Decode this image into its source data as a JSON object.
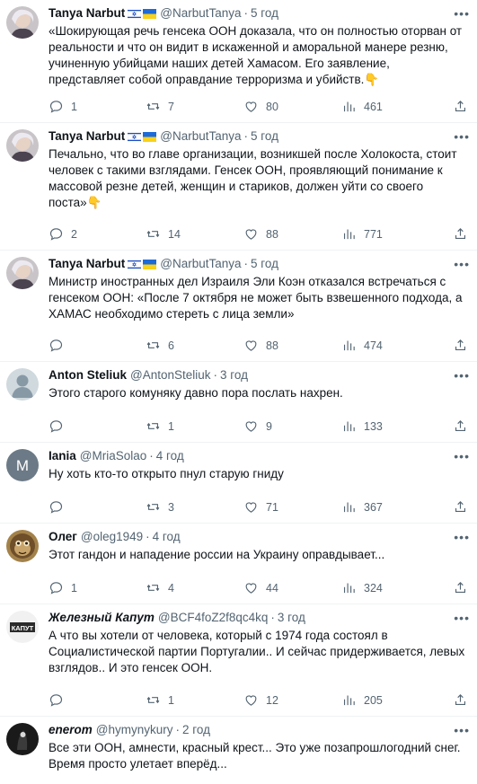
{
  "tweets": [
    {
      "name": "Tanya Narbut",
      "handle": "@NarbutTanya",
      "time": "5 год",
      "flags": true,
      "text": "«Шокирующая речь генсека ООН доказала, что он полностью оторван от реальности и что он видит в искаженной и аморальной манере резню, учиненную убийцами наших детей Хамасом. Его заявление, представляет собой оправдание терроризма и убийств.👇",
      "replies": "1",
      "retweets": "7",
      "likes": "80",
      "views": "461"
    },
    {
      "name": "Tanya Narbut",
      "handle": "@NarbutTanya",
      "time": "5 год",
      "flags": true,
      "text": "Печально, что во главе организации, возникшей после Холокоста, стоит человек с такими взглядами. Генсек ООН, проявляющий понимание к массовой резне детей, женщин и стариков, должен уйти со своего поста»👇",
      "replies": "2",
      "retweets": "14",
      "likes": "88",
      "views": "771"
    },
    {
      "name": "Tanya Narbut",
      "handle": "@NarbutTanya",
      "time": "5 год",
      "flags": true,
      "text": "Министр иностранных дел Израиля Эли Коэн отказался встречаться с генсеком ООН: «После 7 октября не может быть взвешенного подхода, а ХАМАС необходимо стереть с лица земли»",
      "replies": "",
      "retweets": "6",
      "likes": "88",
      "views": "474"
    },
    {
      "name": "Anton Steliuk",
      "handle": "@AntonSteliuk",
      "time": "3 год",
      "flags": false,
      "text": "Этого старого комуняку давно пора послать нахрен.",
      "replies": "",
      "retweets": "1",
      "likes": "9",
      "views": "133"
    },
    {
      "name": "Iania",
      "handle": "@MriaSolao",
      "time": "4 год",
      "flags": false,
      "text": "Ну хоть кто-то открыто пнул старую гниду",
      "replies": "",
      "retweets": "3",
      "likes": "71",
      "views": "367"
    },
    {
      "name": "Олег",
      "handle": "@oleg1949",
      "time": "4 год",
      "flags": false,
      "text": "Этот гандон и нападение россии на Украину оправдывает...",
      "replies": "1",
      "retweets": "4",
      "likes": "44",
      "views": "324"
    },
    {
      "name": "Железный Капут",
      "handle": "@BCF4foZ2f8qc4kq",
      "time": "3 год",
      "flags": false,
      "text": "А что вы хотели от человека, который с 1974 года состоял в Социалистической партии Португалии.. И сейчас придерживается, левых взглядов.. И это генсек ООН.",
      "replies": "",
      "retweets": "1",
      "likes": "12",
      "views": "205",
      "avatar_text": "КАПУТ"
    },
    {
      "name": "enerom",
      "handle": "@hymynykury",
      "time": "2 год",
      "flags": false,
      "text": "Все эти ООН, амнести, красный крест... Это уже позапрошлогодний снег. Время просто улетает вперёд...",
      "replies": "",
      "retweets": "",
      "likes": "",
      "views": ""
    }
  ],
  "avatar_letter_iania": "M",
  "colors": {
    "text": "#0f1419",
    "secondary": "#536471",
    "divider": "#eff3f4",
    "iania_avatar_bg": "#6b7a86"
  },
  "icons": [
    "reply-icon",
    "retweet-icon",
    "like-icon",
    "views-icon",
    "share-icon",
    "more-icon",
    "israel-flag-icon",
    "ukraine-flag-icon"
  ]
}
